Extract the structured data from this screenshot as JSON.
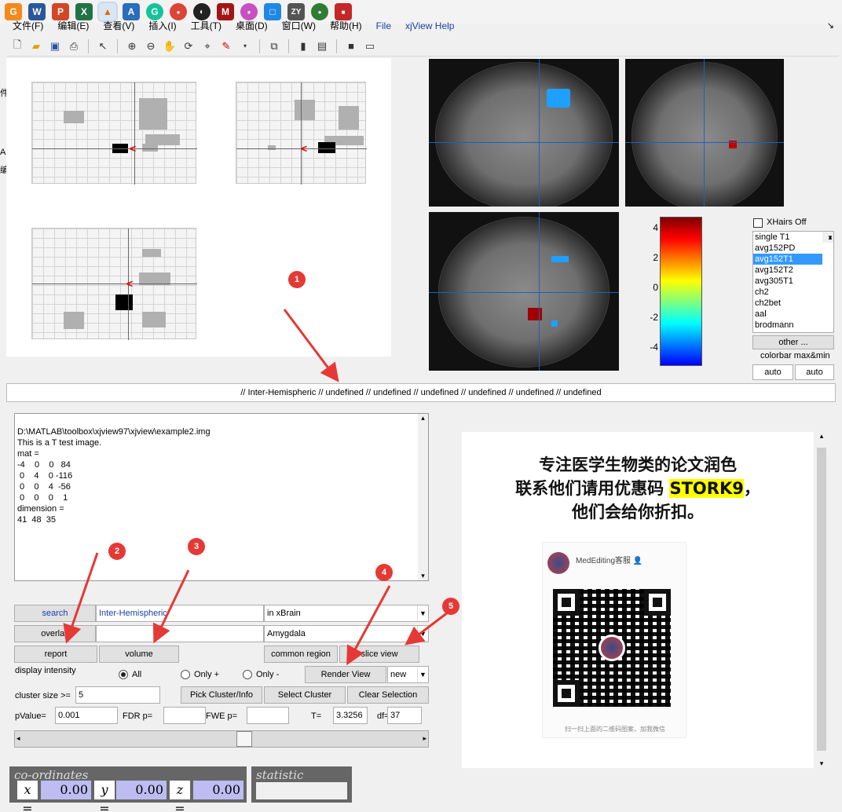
{
  "menu": {
    "items": [
      "文件(F)",
      "编辑(E)",
      "查看(V)",
      "插入(I)",
      "工具(T)",
      "桌面(D)",
      "窗口(W)",
      "帮助(H)",
      "File",
      "xjView Help"
    ]
  },
  "taskbar_icons": [
    "G",
    "W",
    "P",
    "X",
    "▲",
    "A",
    "G",
    "●",
    "◐",
    "M",
    "●",
    "□",
    "ZY",
    "●",
    "■"
  ],
  "sidebar_peeks": [
    "件",
    "A",
    "编"
  ],
  "xhairs": {
    "label": "XHairs Off"
  },
  "template_list": {
    "items": [
      "single T1",
      "avg152PD",
      "avg152T1",
      "avg152T2",
      "avg305T1",
      "ch2",
      "ch2bet",
      "aal",
      "brodmann"
    ],
    "selected": "avg152T1"
  },
  "other_button": "other ...",
  "colorbar": {
    "label": "colorbar max&min",
    "ticks": [
      "4",
      "2",
      "0",
      "-2",
      "-4"
    ],
    "auto_left": "auto",
    "auto_right": "auto"
  },
  "info_bar": "// Inter-Hemispheric // undefined // undefined // undefined // undefined // undefined // undefined",
  "text_output": "D:\\MATLAB\\toolbox\\xjview97\\xjview\\example2.img\nThis is a T test image.\nmat =\n-4    0    0   84\n 0    4    0 -116\n 0    0    4  -56\n 0    0    0    1\ndimension =\n41  48  35",
  "controls": {
    "search_button": "search",
    "search_value": "Inter-Hemispheric",
    "search_scope": "in xBrain",
    "overlay_button": "overlay",
    "overlay_value": "",
    "overlay_select": "Amygdala",
    "report_button": "report",
    "volume_button": "volume",
    "common_region_button": "common region",
    "slice_view_button": "slice view",
    "display_intensity_label": "display intensity",
    "radio_all": "All",
    "radio_pos": "Only +",
    "radio_neg": "Only -",
    "render_view_button": "Render View",
    "render_select": "new",
    "cluster_size_label": "cluster size >=",
    "cluster_size_value": "5",
    "pick_cluster_button": "Pick Cluster/Info",
    "select_cluster_button": "Select Cluster",
    "clear_selection_button": "Clear Selection",
    "pvalue_label": "pValue=",
    "pvalue_value": "0.001",
    "fdr_label": "FDR p=",
    "fdr_value": "",
    "fwe_label": "FWE p=",
    "fwe_value": "",
    "t_label": "T=",
    "t_value": "3.3256",
    "df_label": "df=",
    "df_value": "37"
  },
  "coordinates": {
    "title": "co-ordinates",
    "x_label": "x =",
    "x_value": "0.00",
    "y_label": "y =",
    "y_value": "0.00",
    "z_label": "z =",
    "z_value": "0.00"
  },
  "statistic": {
    "title": "statistic"
  },
  "annotations": [
    "1",
    "2",
    "3",
    "4",
    "5"
  ],
  "ad": {
    "line1": "专注医学生物类的论文润色",
    "line2_prefix": "联系他们请用优惠码",
    "code": "STORK9",
    "line2_suffix": "，",
    "line3": "他们会给你折扣。",
    "account_name": "MedEditing客服",
    "account_badge": "👤",
    "qr_caption": "扫一扫上面的二维码图案，加我微信"
  },
  "colors": {
    "accent_blue": "#1a3fa6",
    "annotation_red": "#e53935",
    "selection_blue": "#3399ff",
    "highlight_yellow": "#ffff00"
  }
}
